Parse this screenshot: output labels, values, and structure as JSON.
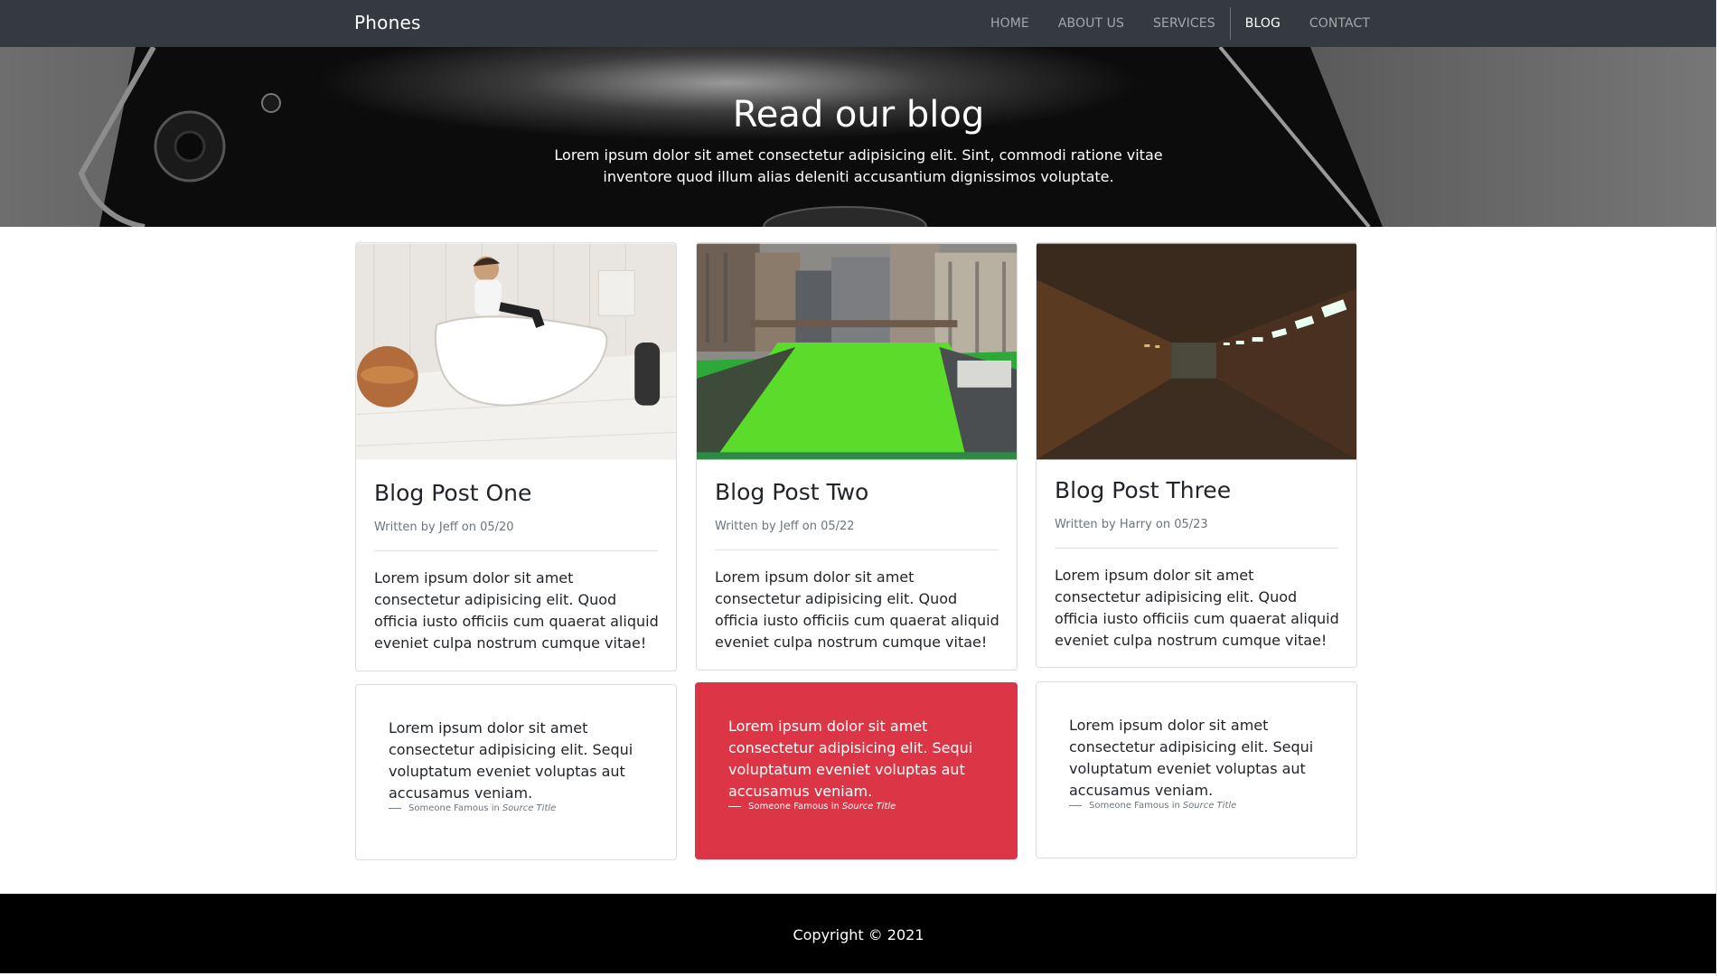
{
  "navbar": {
    "brand": "Phones",
    "links": [
      {
        "label": "HOME",
        "active": false
      },
      {
        "label": "ABOUT US",
        "active": false
      },
      {
        "label": "SERVICES",
        "active": false
      },
      {
        "label": "BLOG",
        "active": true
      },
      {
        "label": "CONTACT",
        "active": false
      }
    ]
  },
  "hero": {
    "title": "Read our blog",
    "subtitle": "Lorem ipsum dolor sit amet consectetur adipisicing elit. Sint, commodi ratione vitae inventore quod illum alias deleniti accusantium dignissimos voluptate."
  },
  "posts": [
    {
      "title": "Blog Post One",
      "meta": "Written by Jeff on 05/20",
      "body": "Lorem ipsum dolor sit amet consectetur adipisicing elit. Quod officia iusto officiis cum quaerat aliquid eveniet culpa nostrum cumque vitae!"
    },
    {
      "title": "Blog Post Two",
      "meta": "Written by Jeff on 05/22",
      "body": "Lorem ipsum dolor sit amet consectetur adipisicing elit. Quod officia iusto officiis cum quaerat aliquid eveniet culpa nostrum cumque vitae!"
    },
    {
      "title": "Blog Post Three",
      "meta": "Written by Harry on 05/23",
      "body": "Lorem ipsum dolor sit amet consectetur adipisicing elit. Quod officia iusto officiis cum quaerat aliquid eveniet culpa nostrum cumque vitae!"
    }
  ],
  "quotes": [
    {
      "text": "Lorem ipsum dolor sit amet consectetur adipisicing elit. Sequi voluptatum eveniet voluptas aut accusamus veniam.",
      "author": "Someone Famous in",
      "source": "Source Title"
    },
    {
      "text": "Lorem ipsum dolor sit amet consectetur adipisicing elit. Sequi voluptatum eveniet voluptas aut accusamus veniam.",
      "author": "Someone Famous in",
      "source": "Source Title"
    },
    {
      "text": "Lorem ipsum dolor sit amet consectetur adipisicing elit. Sequi voluptatum eveniet voluptas aut accusamus veniam.",
      "author": "Someone Famous in",
      "source": "Source Title"
    }
  ],
  "footer": {
    "copyright": "Copyright © 2021"
  },
  "colors": {
    "navbar": "#343a40",
    "accent_red": "#dc3545",
    "footer": "#000000"
  }
}
